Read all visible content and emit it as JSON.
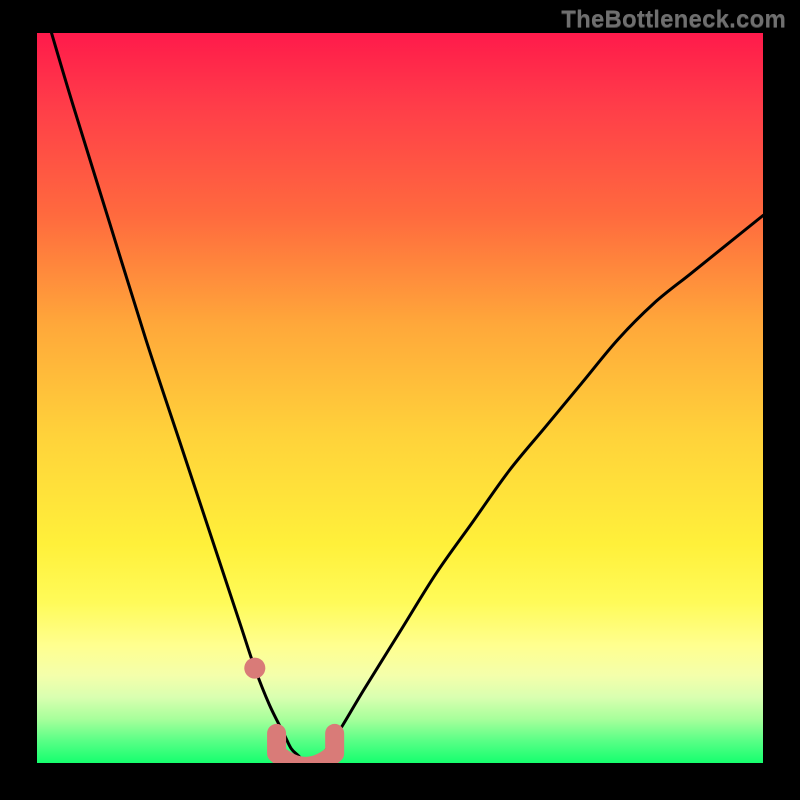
{
  "watermark": {
    "text": "TheBottleneck.com"
  },
  "colors": {
    "frame": "#000000",
    "curve": "#000000",
    "marker": "#d97b78",
    "gradient_top": "#ff1a4b",
    "gradient_bottom": "#15ff6e"
  },
  "chart_data": {
    "type": "line",
    "title": "",
    "xlabel": "",
    "ylabel": "",
    "xlim": [
      0,
      100
    ],
    "ylim": [
      0,
      100
    ],
    "grid": false,
    "series": [
      {
        "name": "bottleneck-curve",
        "x": [
          2,
          5,
          10,
          15,
          20,
          25,
          28,
          30,
          32,
          34,
          35,
          36,
          37,
          38,
          39,
          40,
          42,
          45,
          50,
          55,
          60,
          65,
          70,
          75,
          80,
          85,
          90,
          95,
          100
        ],
        "y": [
          100,
          90,
          74,
          58,
          43,
          28,
          19,
          13,
          8,
          4,
          2,
          1,
          0,
          0,
          1,
          2,
          5,
          10,
          18,
          26,
          33,
          40,
          46,
          52,
          58,
          63,
          67,
          71,
          75
        ]
      }
    ],
    "markers": [
      {
        "name": "left-dot",
        "x": 30,
        "y": 13,
        "r": 1.0
      },
      {
        "name": "marker-bottom",
        "shape": "u",
        "x_start": 33,
        "x_end": 41,
        "y_base": 0.5,
        "thickness": 2.6
      }
    ],
    "legend": false
  }
}
